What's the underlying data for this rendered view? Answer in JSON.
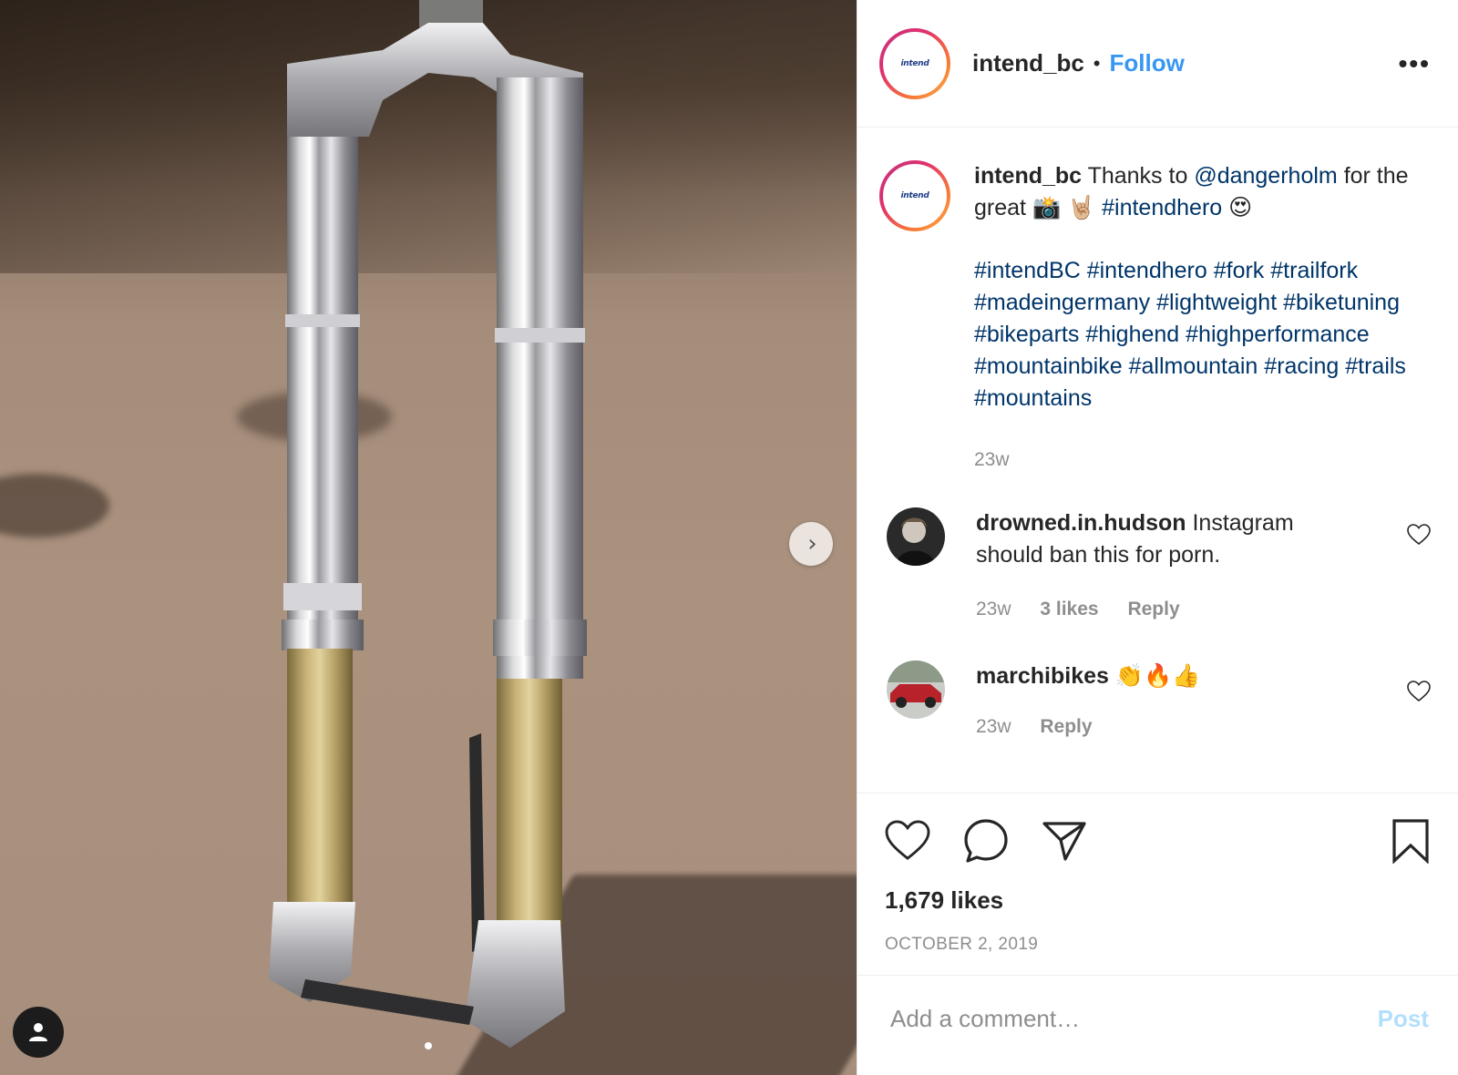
{
  "post": {
    "username": "intend_bc",
    "separator": "•",
    "follow_label": "Follow",
    "more_label": "•••",
    "avatar_logo_text": "intend"
  },
  "caption": {
    "username": "intend_bc",
    "text_1": "Thanks to",
    "mention": "@dangerholm",
    "text_2": "for the great",
    "emoji_camera": "📸",
    "emoji_rock": "🤘🏼",
    "hashtag_first": "#intendhero",
    "emoji_love": "😍",
    "hashtags": [
      "#intendBC",
      "#intendhero",
      "#fork",
      "#trailfork",
      "#madeingermany",
      "#lightweight",
      "#biketuning",
      "#bikeparts",
      "#highend",
      "#highperformance",
      "#mountainbike",
      "#allmountain",
      "#racing",
      "#trails",
      "#mountains"
    ],
    "age": "23w"
  },
  "comments": [
    {
      "username": "drowned.in.hudson",
      "text": "Instagram should ban this for porn.",
      "age": "23w",
      "likes": "3 likes",
      "reply": "Reply"
    },
    {
      "username": "marchibikes",
      "text": "👏🔥👍",
      "age": "23w",
      "reply": "Reply"
    }
  ],
  "likes": "1,679 likes",
  "date": "OCTOBER 2, 2019",
  "add_comment": {
    "placeholder": "Add a comment…",
    "post_label": "Post"
  },
  "icons": {
    "like": "heart-icon",
    "comment": "comment-icon",
    "share": "share-icon",
    "save": "bookmark-icon",
    "next": "chevron-right-icon",
    "user_tags": "user-icon"
  },
  "colors": {
    "link_blue": "#3897f0",
    "hashtag_navy": "#003569",
    "muted": "#8e8e8e",
    "post_disabled": "#b2dffc"
  }
}
